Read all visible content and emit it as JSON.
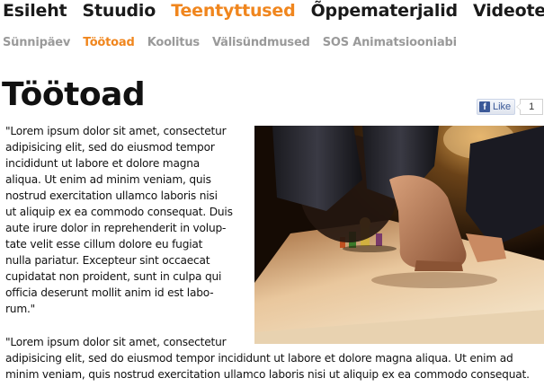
{
  "nav": {
    "main": [
      {
        "label": "Esileht",
        "active": false
      },
      {
        "label": "Stuudio",
        "active": false
      },
      {
        "label": "Teentyttused",
        "active": true
      },
      {
        "label": "Õppematerjalid",
        "active": false
      },
      {
        "label": "Videoteek",
        "active": false
      }
    ],
    "sub": [
      {
        "label": "Sünnipäev",
        "active": false
      },
      {
        "label": "Töötoad",
        "active": true
      },
      {
        "label": "Koolitus",
        "active": false
      },
      {
        "label": "Välisündmused",
        "active": false
      },
      {
        "label": "SOS Animatsiooniabi",
        "active": false
      }
    ]
  },
  "page": {
    "title": "Töötoad"
  },
  "facebook": {
    "icon": "facebook-f-icon",
    "like_label": "Like",
    "count": "1"
  },
  "content": {
    "para1_lines": [
      "\"Lorem ipsum dolor sit amet, consectetur",
      "adipisicing elit, sed do eiusmod tempor",
      "incididunt ut labore et dolore magna",
      "aliqua. Ut enim ad minim veniam, quis",
      "nostrud exercitation ullamco laboris nisi",
      "ut aliquip ex ea commodo consequat. Duis",
      "aute irure dolor in reprehenderit in volup-",
      "tate velit esse cillum dolore eu fugiat",
      "nulla pariatur. Excepteur sint occaecat",
      "cupidatat non proident, sunt in culpa qui",
      "officia deserunt mollit anim id est labo-",
      "rum.\""
    ],
    "para2_lines": [
      "\"Lorem ipsum dolor sit amet, consectetur",
      "adipisicing elit, sed do eiusmod tempor incididunt ut labore et dolore magna aliqua. Ut enim ad",
      "minim veniam, quis nostrud exercitation ullamco laboris nisi ut aliquip ex ea commodo consequat."
    ]
  },
  "colors": {
    "accent": "#f0861e",
    "nav_text": "#1a1a1a",
    "subnav_text": "#9a9a9a",
    "facebook_blue": "#3b5998"
  }
}
